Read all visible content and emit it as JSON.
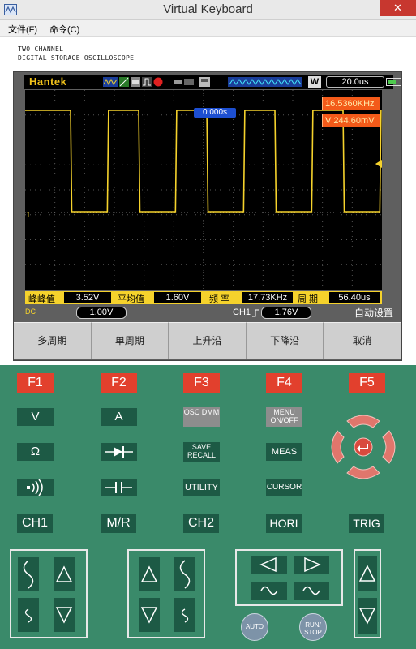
{
  "window": {
    "title": "Virtual Keyboard",
    "close": "✕"
  },
  "menu": {
    "file": "文件(F)",
    "command": "命令(C)"
  },
  "header": {
    "line1": "TWO CHANNEL",
    "line2": "DIGITAL STORAGE OSCILLOSCOPE"
  },
  "scope": {
    "brand": "Hantek",
    "w_label": "W",
    "timebase": "20.0us",
    "trigger_position": "0.000s",
    "frequency_readout": "16.5360KHz",
    "voltage_readout": "V 244.60mV",
    "measurements": [
      {
        "label": "峰峰值",
        "value": "3.52V"
      },
      {
        "label": "平均值",
        "value": "1.60V"
      },
      {
        "label": "频 率",
        "value": "17.73KHz"
      },
      {
        "label": "周 期",
        "value": "56.40us"
      }
    ],
    "ch_coupling": "DC",
    "channel_volts": "1.00V",
    "trigger_channel": "CH1",
    "trigger_level": "1.76V",
    "auto_setup": "自动设置",
    "ch1_marker": "1",
    "softkeys": [
      "多周期",
      "单周期",
      "上升沿",
      "下降沿",
      "取消"
    ]
  },
  "panel": {
    "fkeys": [
      "F1",
      "F2",
      "F3",
      "F4",
      "F5"
    ],
    "row1": [
      "V",
      "A",
      "OSC DMM",
      "MENU ON/OFF"
    ],
    "row2": [
      "Ω",
      "",
      "SAVE RECALL",
      "MEAS"
    ],
    "row3": [
      "",
      "",
      "UTILITY",
      "CURSOR"
    ],
    "row4": [
      "CH1",
      "M/R",
      "CH2",
      "HORI",
      "TRIG"
    ],
    "auto": "AUTO",
    "runstop": "RUN/ STOP"
  },
  "colors": {
    "panel_bg": "#3a8a6a",
    "key_red": "#e2402d",
    "key_green": "#1d5a45",
    "trace": "#f5d22c"
  }
}
